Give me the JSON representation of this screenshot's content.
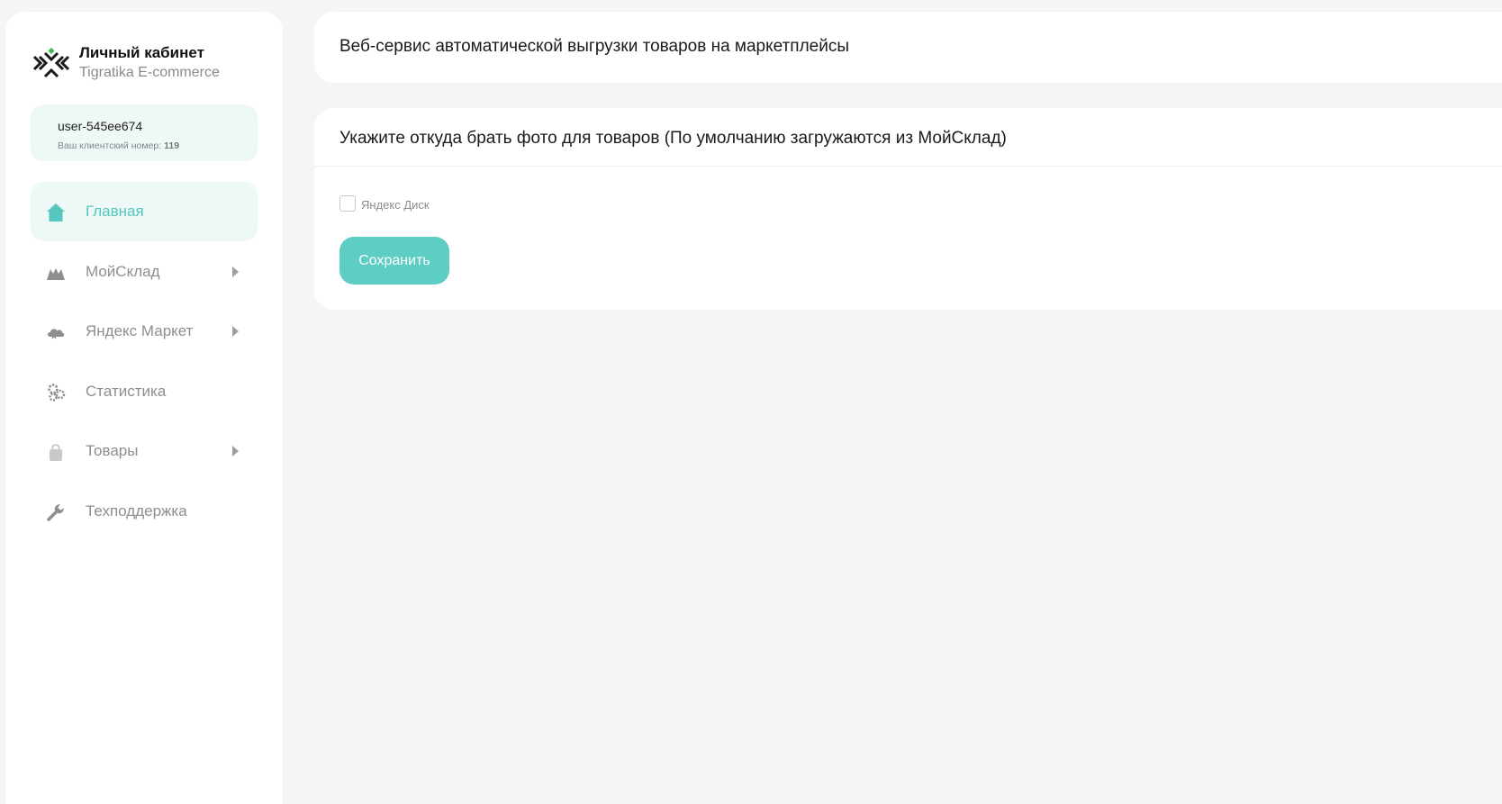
{
  "brand": {
    "title": "Личный кабинет",
    "subtitle": "Tigratika E-commerce"
  },
  "user": {
    "name": "user-545ee674",
    "client_label": "Ваш клиентский номер:",
    "client_number": "119"
  },
  "sidebar": {
    "items": [
      {
        "label": "Главная",
        "icon": "home-icon",
        "active": true,
        "has_submenu": false
      },
      {
        "label": "МойСклад",
        "icon": "mountains-icon",
        "active": false,
        "has_submenu": true
      },
      {
        "label": "Яндекс Маркет",
        "icon": "cloud-icon",
        "active": false,
        "has_submenu": true
      },
      {
        "label": "Статистика",
        "icon": "cogs-icon",
        "active": false,
        "has_submenu": false
      },
      {
        "label": "Товары",
        "icon": "shopping-bag-icon",
        "active": false,
        "has_submenu": true
      },
      {
        "label": "Техподдержка",
        "icon": "wrench-icon",
        "active": false,
        "has_submenu": false
      }
    ]
  },
  "header": {
    "title": "Веб-сервис автоматической выгрузки товаров на маркетплейсы"
  },
  "photo_settings": {
    "title": "Укажите откуда брать фото для товаров (По умолчанию загружаются из МойСклад)",
    "option_label": "Яндекс Диск",
    "option_checked": false,
    "save_label": "Сохранить"
  },
  "colors": {
    "accent": "#5ecdc3",
    "active_bg": "#eef8f7",
    "background": "#f5f5f5"
  }
}
